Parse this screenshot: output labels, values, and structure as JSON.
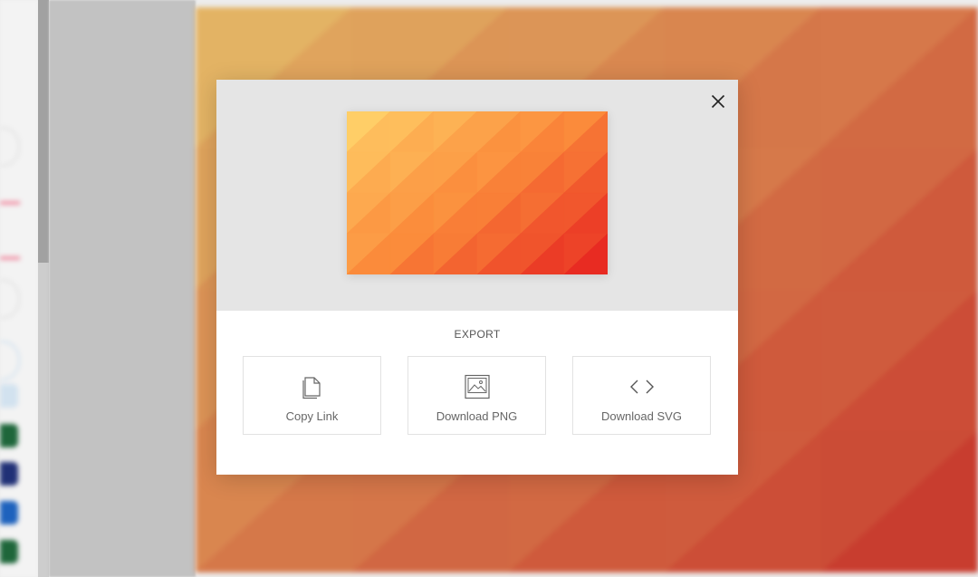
{
  "modal": {
    "close_icon": "close-icon",
    "export_title": "EXPORT",
    "actions": [
      {
        "label": "Copy Link",
        "icon": "copy-icon"
      },
      {
        "label": "Download PNG",
        "icon": "image-icon"
      },
      {
        "label": "Download SVG",
        "icon": "code-icon"
      }
    ]
  },
  "colors": {
    "preview_light": "#ffd36a",
    "preview_mid": "#fb8a3a",
    "preview_dark": "#e6211f",
    "background_canvas_light": "#e3b45a",
    "background_canvas_dark": "#c2261b",
    "swatches": [
      "#0b5a2a",
      "#0e1f6b",
      "#0b55b8",
      "#0b5a2a"
    ]
  }
}
